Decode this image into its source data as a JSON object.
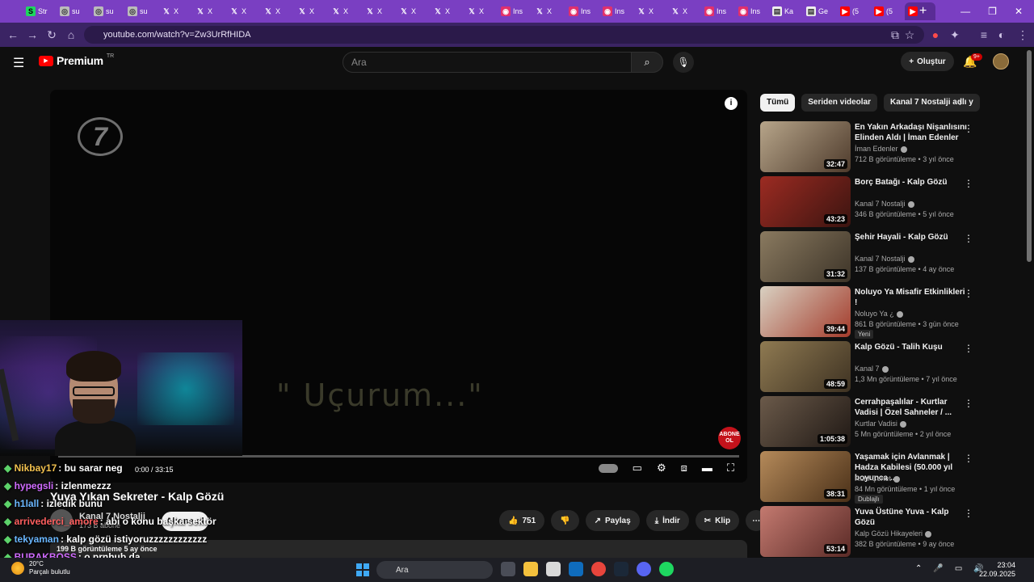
{
  "browser": {
    "tabs": [
      {
        "label": "Str",
        "fav": "green"
      },
      {
        "label": "su",
        "fav": "gray"
      },
      {
        "label": "su",
        "fav": "gray"
      },
      {
        "label": "su",
        "fav": "gray"
      },
      {
        "label": "X",
        "fav": "x"
      },
      {
        "label": "X",
        "fav": "x"
      },
      {
        "label": "X",
        "fav": "x"
      },
      {
        "label": "X",
        "fav": "x"
      },
      {
        "label": "X",
        "fav": "x"
      },
      {
        "label": "X",
        "fav": "x"
      },
      {
        "label": "X",
        "fav": "x"
      },
      {
        "label": "X",
        "fav": "x"
      },
      {
        "label": "X",
        "fav": "x"
      },
      {
        "label": "X",
        "fav": "x"
      },
      {
        "label": "Ins",
        "fav": "ig"
      },
      {
        "label": "X",
        "fav": "x"
      },
      {
        "label": "Ins",
        "fav": "ig"
      },
      {
        "label": "Ins",
        "fav": "ig"
      },
      {
        "label": "X",
        "fav": "x"
      },
      {
        "label": "X",
        "fav": "x"
      },
      {
        "label": "Ins",
        "fav": "ig"
      },
      {
        "label": "Ins",
        "fav": "ig"
      },
      {
        "label": "Ka",
        "fav": "doc"
      },
      {
        "label": "Ge",
        "fav": "doc"
      },
      {
        "label": "(5",
        "fav": "yt"
      },
      {
        "label": "(5",
        "fav": "yt"
      },
      {
        "label": "",
        "fav": "yt"
      }
    ],
    "url": "youtube.com/watch?v=Zw3UrRfHIDA"
  },
  "header": {
    "logo_text": "Premium",
    "logo_sup": "TR",
    "search_placeholder": "Ara",
    "create_label": "Oluştur",
    "notif_badge": "9+"
  },
  "player": {
    "channel_logo": "7",
    "caption": "\" Uçurum...\"",
    "subscribe_badge_line1": "ABONE",
    "subscribe_badge_line2": "OL",
    "time": "0:00 / 33:15"
  },
  "chat": [
    {
      "user": "Nikbay17",
      "text": ": bu sarar neg",
      "color": "#f2c14e"
    },
    {
      "user": "hypegsli",
      "text": ": izlenmezzz",
      "color": "#d06bff"
    },
    {
      "user": "h1lall",
      "text": ": izledik bunu",
      "color": "#6ab7ff"
    },
    {
      "user": "arrivederci_amore",
      "text": ": abi o konu başka sektör",
      "color": "#ff5e5e"
    },
    {
      "user": "tekyaman",
      "text": ": kalp gözü istiyoruzzzzzzzzzzzz",
      "color": "#6ab7ff"
    },
    {
      "user": "BURAKBOSS",
      "text": ": o prnhub da",
      "color": "#d06bff"
    }
  ],
  "video": {
    "title": "Yuva Yıkan Sekreter - Kalp Gözü",
    "channel": "Kanal 7 Nostalji",
    "subs": "173 B abone",
    "subscribe_label": "Abone ol",
    "likes": "751",
    "share_label": "Paylaş",
    "download_label": "İndir",
    "clip_label": "Klip",
    "desc_meta": "199 B görüntüleme  5 ay önce"
  },
  "chips": [
    "Tümü",
    "Seriden videolar",
    "Kanal 7 Nostalji adlı y"
  ],
  "recs": [
    {
      "title": "En Yakın Arkadaşı Nişanlısını Elinden Aldı | İman Edenler",
      "channel": "İman Edenler",
      "meta": "712 B görüntüleme • 3 yıl önce",
      "duration": "32:47",
      "c1": "#b7a58a",
      "c2": "#4e3b2c"
    },
    {
      "title": "Borç Batağı - Kalp Gözü",
      "channel": "Kanal 7 Nostalji",
      "meta": "346 B görüntüleme • 5 yıl önce",
      "duration": "43:23",
      "c1": "#9c2b22",
      "c2": "#3b1410"
    },
    {
      "title": "Şehir Hayali - Kalp Gözü",
      "channel": "Kanal 7 Nostalji",
      "meta": "137 B görüntüleme • 4 ay önce",
      "duration": "31:32",
      "c1": "#8a7a60",
      "c2": "#3d3428"
    },
    {
      "title": "Noluyo Ya Misafir Etkinlikleri !",
      "channel": "Noluyo Ya ¿",
      "meta": "861 B görüntüleme • 3 gün önce",
      "duration": "39:44",
      "tag": "Yeni",
      "c1": "#d9d1c2",
      "c2": "#a33b2b"
    },
    {
      "title": "Kalp Gözü - Talih Kuşu",
      "channel": "Kanal 7",
      "meta": "1,3 Mn görüntüleme • 7 yıl önce",
      "duration": "48:59",
      "c1": "#8f7a52",
      "c2": "#3e3222"
    },
    {
      "title": "Cerrahpaşalılar - Kurtlar Vadisi | Özel Sahneler / ...",
      "channel": "Kurtlar Vadisi",
      "meta": "5 Mn görüntüleme • 2 yıl önce",
      "duration": "1:05:38",
      "c1": "#6b5a4a",
      "c2": "#1f1814"
    },
    {
      "title": "Yaşamak için Avlanmak | Hadza Kabilesi (50.000 yıl boyunca ...",
      "channel": "Ruhi Çenet",
      "meta": "84 Mn görüntüleme • 1 yıl önce",
      "duration": "38:31",
      "tag": "Dublajlı",
      "c1": "#b58a5a",
      "c2": "#4a3018"
    },
    {
      "title": "Yuva Üstüne Yuva - Kalp Gözü",
      "channel": "Kalp Gözü Hikayeleri",
      "meta": "382 B görüntüleme • 9 ay önce",
      "duration": "53:14",
      "c1": "#c47a70",
      "c2": "#5a2a26"
    }
  ],
  "taskbar": {
    "temp": "20°C",
    "weather": "Parçalı bulutlu",
    "search": "Ara",
    "time": "23:04",
    "date": "22.09.2025"
  }
}
